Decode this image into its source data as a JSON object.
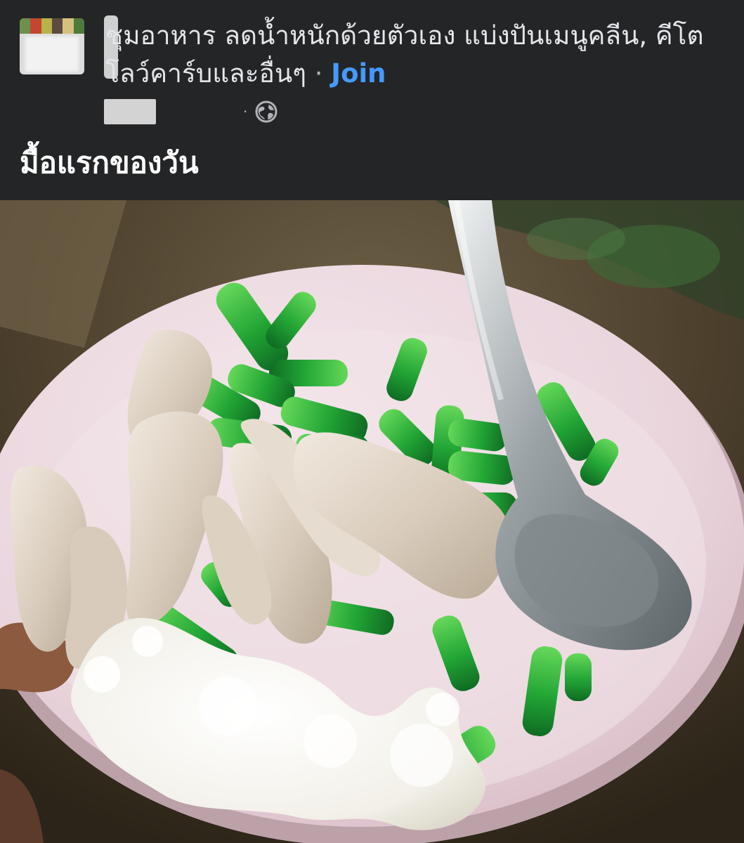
{
  "post": {
    "group_name": "ลดน้ำหนักด้วยตัวเอง แบ่งปันเมนูคลีน, คีโต โลว์คาร์บและอื่นๆ",
    "group_name_prefix": "ชุมอาหาร ",
    "visible_group_text": "ชุมอาหาร ลดน้ำหนักด้วยตัวเอง แบ่งปันเมนูคลีน, คีโต โลว์คาร์บและอื่นๆ",
    "separator": " · ",
    "join_label": "Join",
    "meta_separator": "·",
    "privacy_icon": "globe-icon",
    "text": "มื้อแรกของวัน"
  },
  "photo": {
    "description_icon": "food-plate-photo",
    "items": [
      "boiled pork slices",
      "steamed rice",
      "long beans",
      "metal spoon"
    ]
  },
  "colors": {
    "background": "#242526",
    "text": "#e4e6eb",
    "muted": "#b0b3b8",
    "link": "#4599ff"
  }
}
